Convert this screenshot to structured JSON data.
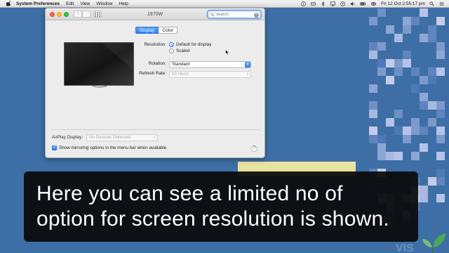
{
  "menubar": {
    "app": "System Preferences",
    "items": [
      "Edit",
      "View",
      "Window",
      "Help"
    ],
    "clock": "Fri 12 Oct  2:55:17 pm"
  },
  "window": {
    "title": "1970W",
    "search_placeholder": "Search",
    "tabs": {
      "display": "Display",
      "color": "Color"
    },
    "resolution": {
      "label": "Resolution:",
      "options": [
        "Default for display",
        "Scaled"
      ],
      "selected": "Default for display"
    },
    "rotation": {
      "label": "Rotation:",
      "value": "Standard"
    },
    "refresh_rate": {
      "label": "Refresh Rate:",
      "value": "60 Hertz"
    },
    "airplay": {
      "label": "AirPlay Display:",
      "value": "No Devices Detected"
    },
    "mirroring": {
      "label": "Show mirroring options in the menu bar when available",
      "checked": true
    },
    "help": "?"
  },
  "caption": {
    "text": "Here you can see a limited no of option for screen resolution is shown."
  },
  "colors": {
    "desktop": "#3d6fa6",
    "accent": "#2d7ff0",
    "caption_bg": "#0a0a0a"
  }
}
